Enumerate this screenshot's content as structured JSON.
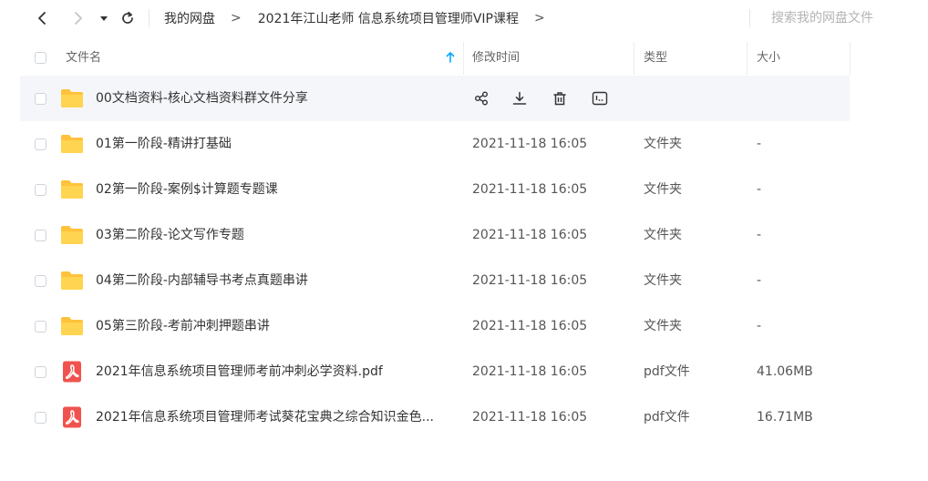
{
  "nav": {
    "back_icon": "chevron-left-icon",
    "forward_icon": "chevron-right-icon",
    "dropdown_icon": "caret-down-icon",
    "refresh_icon": "refresh-icon",
    "breadcrumb": [
      "我的网盘",
      "2021年江山老师 信息系统项目管理师VIP课程"
    ],
    "breadcrumb_separator": ">",
    "search_placeholder": "搜索我的网盘文件"
  },
  "table": {
    "columns": {
      "name": "文件名",
      "modified": "修改时间",
      "type": "类型",
      "size": "大小"
    },
    "sort_icon": "arrow-up-icon",
    "accent_color": "#06a7ff",
    "hover_actions": [
      "share-icon",
      "download-icon",
      "delete-icon",
      "more-icon"
    ],
    "rows": [
      {
        "icon": "folder-icon",
        "name": "00文档资料-核心文档资料群文件分享",
        "modified": "",
        "type": "",
        "size": "",
        "hover": true
      },
      {
        "icon": "folder-icon",
        "name": "01第一阶段-精讲打基础",
        "modified": "2021-11-18 16:05",
        "type": "文件夹",
        "size": "-"
      },
      {
        "icon": "folder-icon",
        "name": "02第一阶段-案例$计算题专题课",
        "modified": "2021-11-18 16:05",
        "type": "文件夹",
        "size": "-"
      },
      {
        "icon": "folder-icon",
        "name": "03第二阶段-论文写作专题",
        "modified": "2021-11-18 16:05",
        "type": "文件夹",
        "size": "-"
      },
      {
        "icon": "folder-icon",
        "name": "04第二阶段-内部辅导书考点真题串讲",
        "modified": "2021-11-18 16:05",
        "type": "文件夹",
        "size": "-"
      },
      {
        "icon": "folder-icon",
        "name": "05第三阶段-考前冲刺押题串讲",
        "modified": "2021-11-18 16:05",
        "type": "文件夹",
        "size": "-"
      },
      {
        "icon": "pdf-icon",
        "name": "2021年信息系统项目管理师考前冲刺必学资料.pdf",
        "modified": "2021-11-18 16:05",
        "type": "pdf文件",
        "size": "41.06MB"
      },
      {
        "icon": "pdf-icon",
        "name": "2021年信息系统项目管理师考试葵花宝典之综合知识金色...",
        "modified": "2021-11-18 16:05",
        "type": "pdf文件",
        "size": "16.71MB"
      }
    ]
  }
}
